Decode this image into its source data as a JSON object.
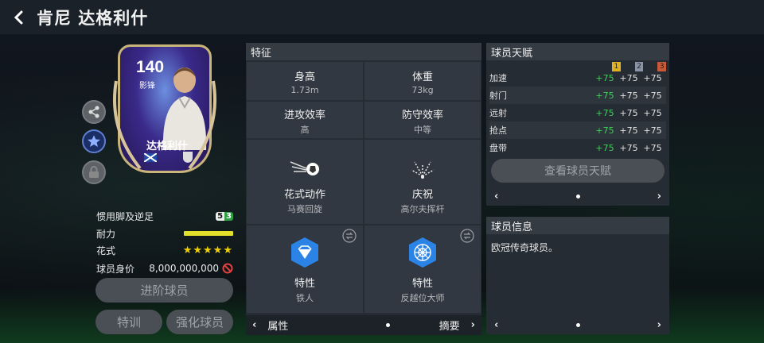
{
  "header": {
    "title": "肯尼 达格利什"
  },
  "card": {
    "rating": "140",
    "position": "影锋",
    "name": "达格利什"
  },
  "info": {
    "foot_label": "惯用脚及逆足",
    "foot_value_left": "5",
    "foot_value_right": "3",
    "stamina_label": "耐力",
    "stamina_level": 1.0,
    "skill_label": "花式",
    "skill_stars": 5,
    "value_label": "球员身价",
    "value_amount": "8,000,000,000"
  },
  "buttons": {
    "advance": "进阶球员",
    "train": "特训",
    "enhance": "强化球员"
  },
  "traits": {
    "title": "特征",
    "height_label": "身高",
    "height_value": "1.73m",
    "weight_label": "体重",
    "weight_value": "73kg",
    "att_label": "进攻效率",
    "att_value": "高",
    "def_label": "防守效率",
    "def_value": "中等",
    "skill_move_label": "花式动作",
    "skill_move_value": "马赛回旋",
    "celebration_label": "庆祝",
    "celebration_value": "高尔夫挥杆",
    "trait1_label": "特性",
    "trait1_value": "铁人",
    "trait2_label": "特性",
    "trait2_value": "反越位大师",
    "pager_left": "属性",
    "pager_right": "摘要"
  },
  "talent": {
    "title": "球员天赋",
    "levels": [
      "1",
      "2",
      "3"
    ],
    "level_colors": [
      "#e0b020",
      "#8a94a8",
      "#c85a3a"
    ],
    "rows": [
      {
        "label": "加速",
        "v1": "+75",
        "v2": "+75",
        "v3": "+75"
      },
      {
        "label": "射门",
        "v1": "+75",
        "v2": "+75",
        "v3": "+75"
      },
      {
        "label": "远射",
        "v1": "+75",
        "v2": "+75",
        "v3": "+75"
      },
      {
        "label": "抢点",
        "v1": "+75",
        "v2": "+75",
        "v3": "+75"
      },
      {
        "label": "盘带",
        "v1": "+75",
        "v2": "+75",
        "v3": "+75"
      }
    ],
    "view_button": "查看球员天赋"
  },
  "player_info": {
    "title": "球员信息",
    "text": "欧冠传奇球员。"
  },
  "icons": {
    "back": "chevron-left-icon",
    "share": "share-icon",
    "star": "star-icon",
    "lock": "lock-icon",
    "forbid": "forbid-icon",
    "swap": "swap-icon"
  }
}
